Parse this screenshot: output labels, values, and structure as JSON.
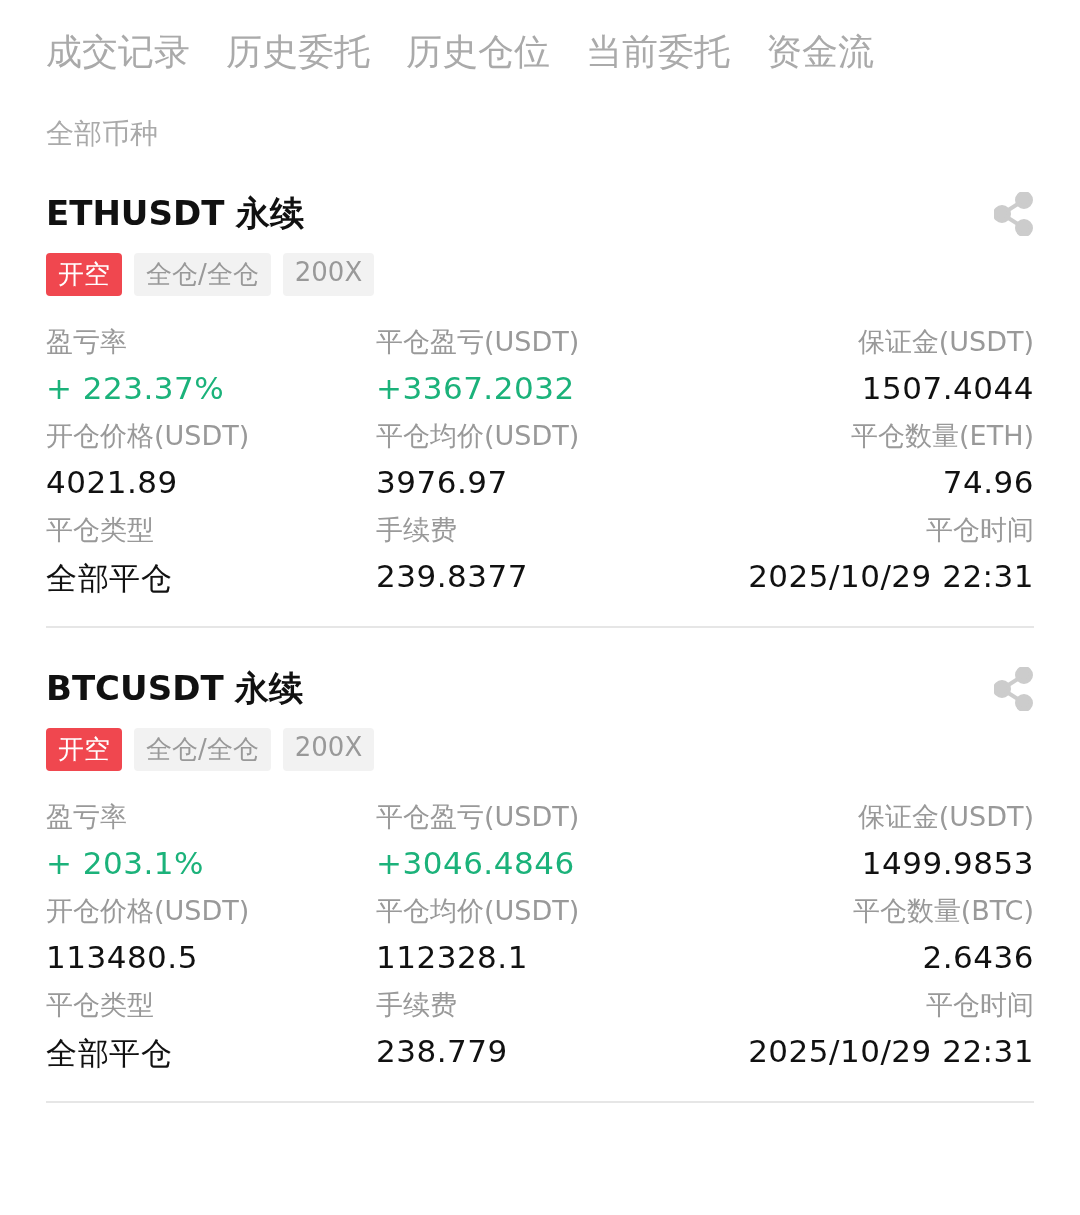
{
  "tabs": [
    {
      "label": "成交记录",
      "selected": false
    },
    {
      "label": "历史委托",
      "selected": false
    },
    {
      "label": "历史仓位",
      "selected": false
    },
    {
      "label": "当前委托",
      "selected": false
    },
    {
      "label": "资金流",
      "selected": false
    }
  ],
  "filter": {
    "label": "全部币种"
  },
  "positions": [
    {
      "symbol": "ETHUSDT 永续",
      "tags": [
        {
          "label": "开空",
          "kind": "side"
        },
        {
          "label": "全仓/全仓",
          "kind": "plain"
        },
        {
          "label": "200X",
          "kind": "plain"
        }
      ],
      "fields": [
        {
          "label": "盈亏率",
          "value": "+ 223.37%",
          "kind": "profit"
        },
        {
          "label": "平仓盈亏(USDT)",
          "value": "+3367.2032",
          "kind": "profit"
        },
        {
          "label": "保证金(USDT)",
          "value": "1507.4044",
          "kind": "plain"
        },
        {
          "label": "开仓价格(USDT)",
          "value": "4021.89",
          "kind": "plain"
        },
        {
          "label": "平仓均价(USDT)",
          "value": "3976.97",
          "kind": "plain"
        },
        {
          "label": "平仓数量(ETH)",
          "value": "74.96",
          "kind": "plain"
        },
        {
          "label": "平仓类型",
          "value": "全部平仓",
          "kind": "plain"
        },
        {
          "label": "手续费",
          "value": "239.8377",
          "kind": "plain"
        },
        {
          "label": "平仓时间",
          "value": "2025/10/29 22:31",
          "kind": "plain"
        }
      ]
    },
    {
      "symbol": "BTCUSDT 永续",
      "tags": [
        {
          "label": "开空",
          "kind": "side"
        },
        {
          "label": "全仓/全仓",
          "kind": "plain"
        },
        {
          "label": "200X",
          "kind": "plain"
        }
      ],
      "fields": [
        {
          "label": "盈亏率",
          "value": "+ 203.1%",
          "kind": "profit"
        },
        {
          "label": "平仓盈亏(USDT)",
          "value": "+3046.4846",
          "kind": "profit"
        },
        {
          "label": "保证金(USDT)",
          "value": "1499.9853",
          "kind": "plain"
        },
        {
          "label": "开仓价格(USDT)",
          "value": "113480.5",
          "kind": "plain"
        },
        {
          "label": "平仓均价(USDT)",
          "value": "112328.1",
          "kind": "plain"
        },
        {
          "label": "平仓数量(BTC)",
          "value": "2.6436",
          "kind": "plain"
        },
        {
          "label": "平仓类型",
          "value": "全部平仓",
          "kind": "plain"
        },
        {
          "label": "手续费",
          "value": "238.779",
          "kind": "plain"
        },
        {
          "label": "平仓时间",
          "value": "2025/10/29 22:31",
          "kind": "plain"
        }
      ]
    }
  ]
}
